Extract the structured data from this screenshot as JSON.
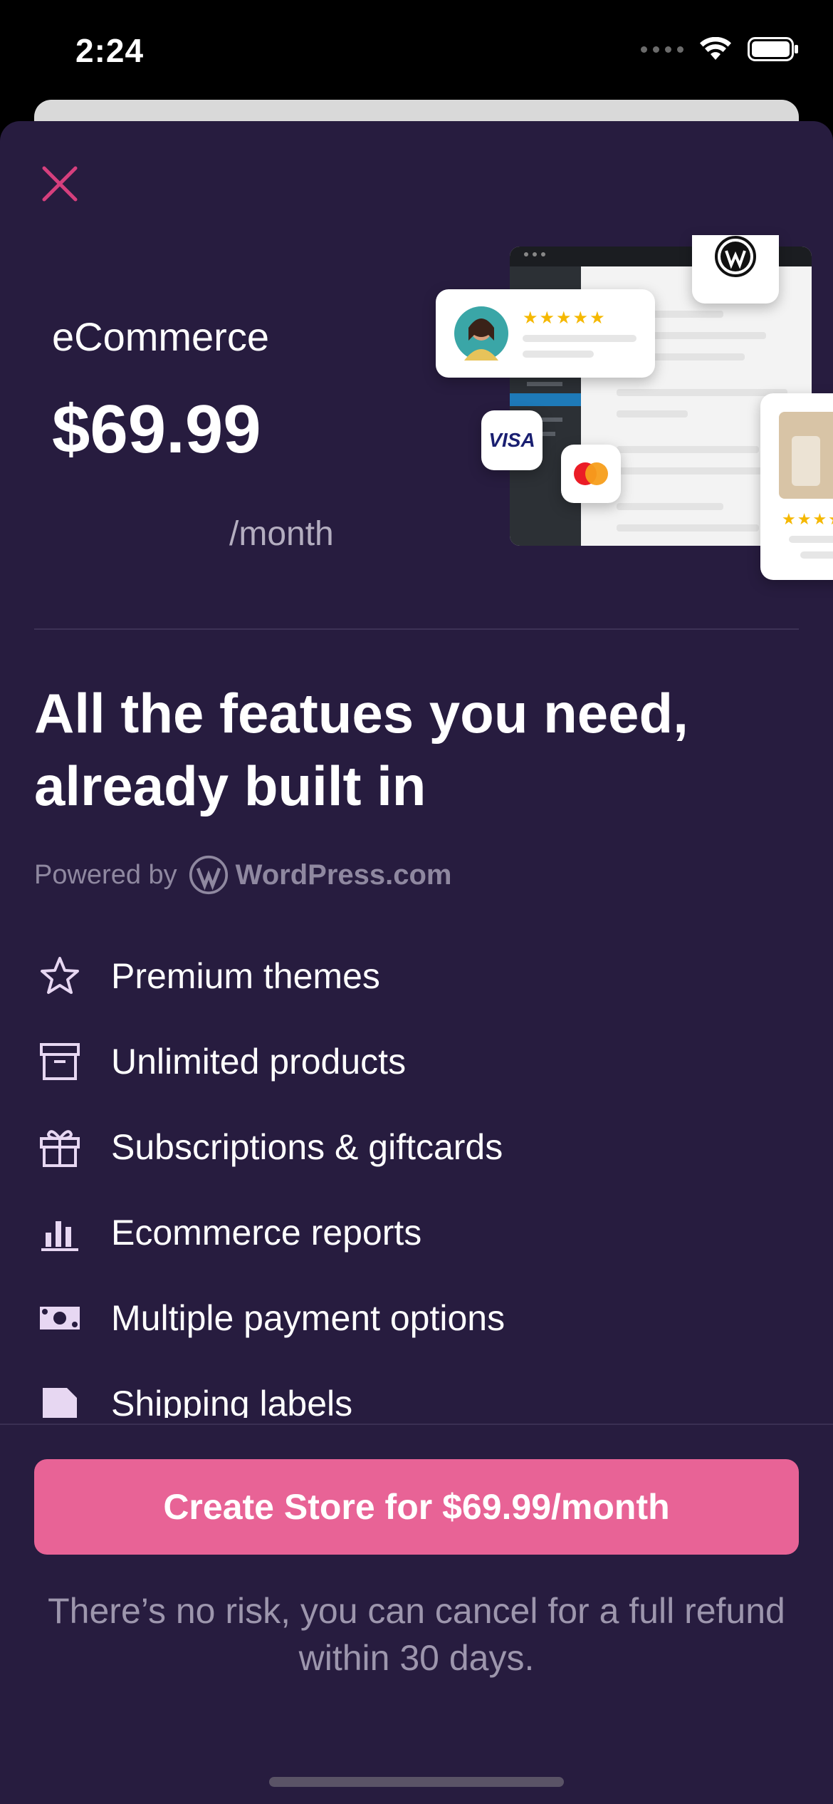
{
  "status_bar": {
    "time": "2:24"
  },
  "sheet": {
    "plan": {
      "name": "eCommerce",
      "price": "$69.99",
      "period": "/month"
    },
    "headline": "All the featues you need, already built in",
    "powered_by": {
      "prefix": "Powered by",
      "brand": "WordPress.com"
    },
    "features": [
      {
        "icon": "star-icon",
        "label": "Premium themes"
      },
      {
        "icon": "archive-box-icon",
        "label": "Unlimited products"
      },
      {
        "icon": "gift-icon",
        "label": "Subscriptions & giftcards"
      },
      {
        "icon": "bar-chart-icon",
        "label": "Ecommerce reports"
      },
      {
        "icon": "money-icon",
        "label": "Multiple payment options"
      },
      {
        "icon": "shipping-label-icon",
        "label": "Shipping labels"
      }
    ],
    "cta_label": "Create Store for $69.99/month",
    "refund_note": "There’s no risk, you can cancel for a full refund within 30 days.",
    "illustration": {
      "card_brand": "VISA"
    }
  },
  "colors": {
    "sheet_bg": "#271c3f",
    "accent_pink": "#e86396",
    "close_icon": "#d63f7d",
    "feature_icon": "#e7d7f2",
    "muted_text": "#9d96ad"
  }
}
